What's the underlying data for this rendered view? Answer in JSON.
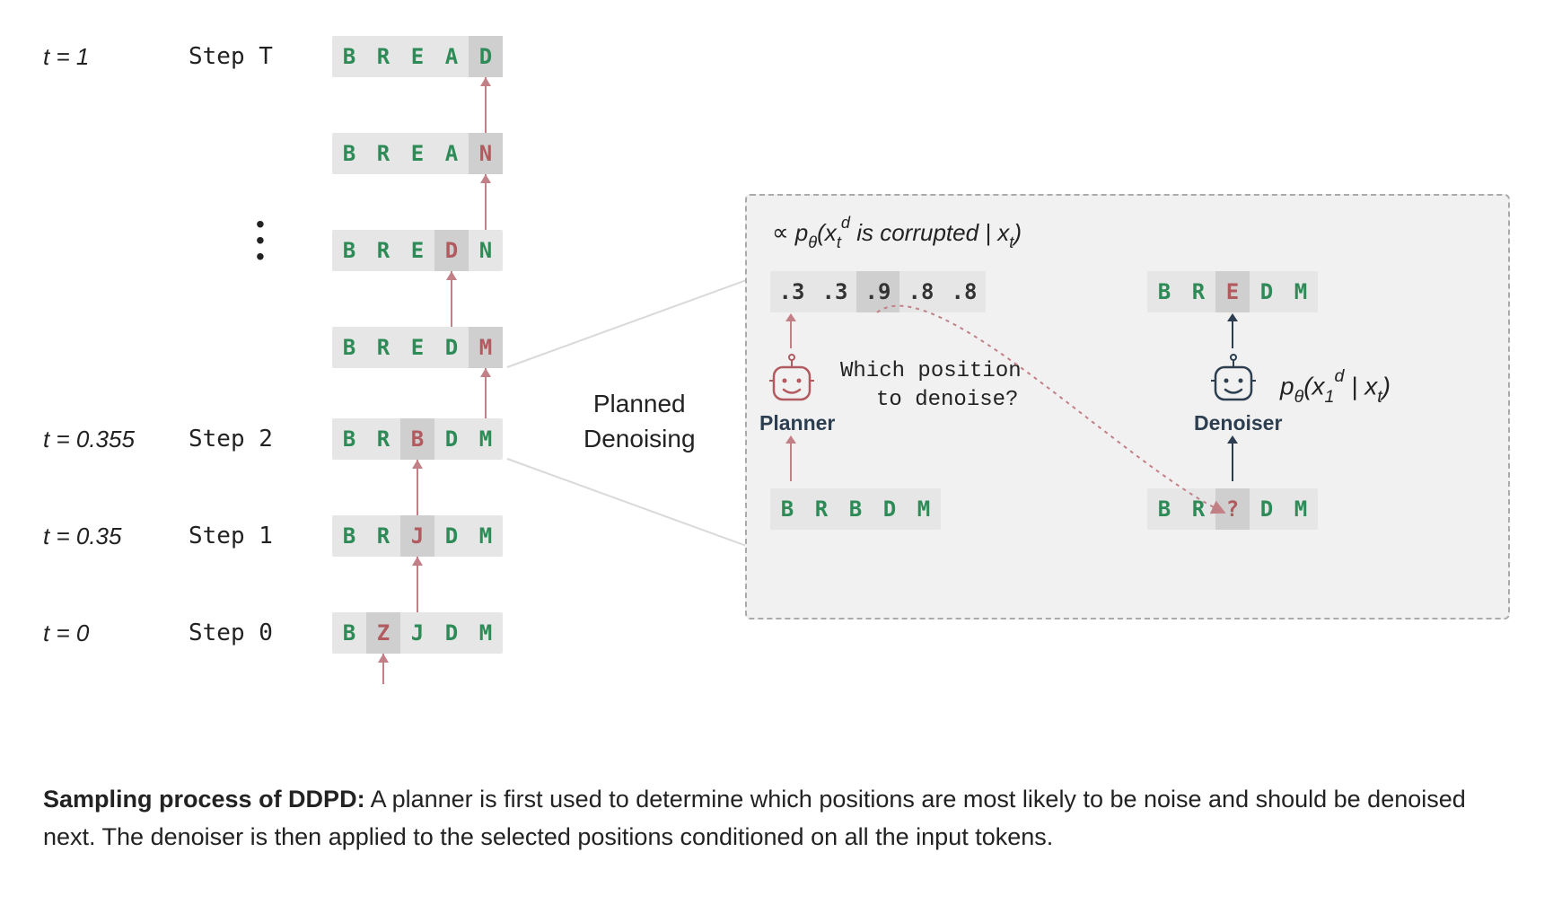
{
  "left": {
    "time_labels": {
      "t_top": "t = 1",
      "t_step2": "t = 0.355",
      "t_step1": "t = 0.35",
      "t_start": "t = 0"
    },
    "step_labels": {
      "top": "Step T",
      "s2": "Step 2",
      "s1": "Step 1",
      "s0": "Step 0"
    },
    "rows": {
      "r_top": {
        "chars": [
          "B",
          "R",
          "E",
          "A",
          "D"
        ],
        "classes": [
          "g",
          "g",
          "g",
          "g",
          "g"
        ],
        "highlight": 4
      },
      "r_t1": {
        "chars": [
          "B",
          "R",
          "E",
          "A",
          "N"
        ],
        "classes": [
          "g",
          "g",
          "g",
          "g",
          "r"
        ],
        "highlight": 4
      },
      "r_t2": {
        "chars": [
          "B",
          "R",
          "E",
          "D",
          "N"
        ],
        "classes": [
          "g",
          "g",
          "g",
          "r",
          "g"
        ],
        "highlight": 3
      },
      "r_t3": {
        "chars": [
          "B",
          "R",
          "E",
          "D",
          "M"
        ],
        "classes": [
          "g",
          "g",
          "g",
          "g",
          "r"
        ],
        "highlight": 4
      },
      "r_step2": {
        "chars": [
          "B",
          "R",
          "B",
          "D",
          "M"
        ],
        "classes": [
          "g",
          "g",
          "r",
          "g",
          "g"
        ],
        "highlight": 2
      },
      "r_step1": {
        "chars": [
          "B",
          "R",
          "J",
          "D",
          "M"
        ],
        "classes": [
          "g",
          "g",
          "r",
          "g",
          "g"
        ],
        "highlight": 2
      },
      "r_step0": {
        "chars": [
          "B",
          "Z",
          "J",
          "D",
          "M"
        ],
        "classes": [
          "g",
          "r",
          "g",
          "g",
          "g"
        ],
        "highlight": 1
      }
    }
  },
  "mid_label_1": "Planned",
  "mid_label_2": "Denoising",
  "panel": {
    "corrupt_prop_prefix": "∝ ",
    "corrupt_prop_html": "p<sub class='math'>θ</sub>(x<sub class='math'>t</sub><sup class='math'>d</sup> is corrupted | x<sub class='math'>t</sub>)",
    "probs": {
      "cells": [
        ".3",
        ".3",
        ".9",
        ".8",
        ".8"
      ],
      "highlight": 2
    },
    "planner_title": "Planner",
    "planner_q1": "Which position",
    "planner_q2": "to denoise?",
    "planner_input": {
      "chars": [
        "B",
        "R",
        "B",
        "D",
        "M"
      ],
      "classes": [
        "g",
        "g",
        "g",
        "g",
        "g"
      ]
    },
    "denoiser_title": "Denoiser",
    "denoiser_out": {
      "chars": [
        "B",
        "R",
        "E",
        "D",
        "M"
      ],
      "classes": [
        "g",
        "g",
        "r",
        "g",
        "g"
      ],
      "highlight": 2
    },
    "denoiser_in": {
      "chars": [
        "B",
        "R",
        "?",
        "D",
        "M"
      ],
      "classes": [
        "g",
        "g",
        "q",
        "g",
        "g"
      ],
      "highlight": 2
    },
    "denoiser_math_html": "p<sub class='math'>θ</sub>(x<sub class='math'>1</sub><sup class='math'>d</sup> | x<sub class='math'>t</sub>)"
  },
  "caption": {
    "bold": "Sampling process of DDPD:",
    "rest": " A planner is first used to determine which positions are most likely to be noise and should be denoised next. The denoiser is then applied to the selected positions conditioned on all the input tokens."
  }
}
